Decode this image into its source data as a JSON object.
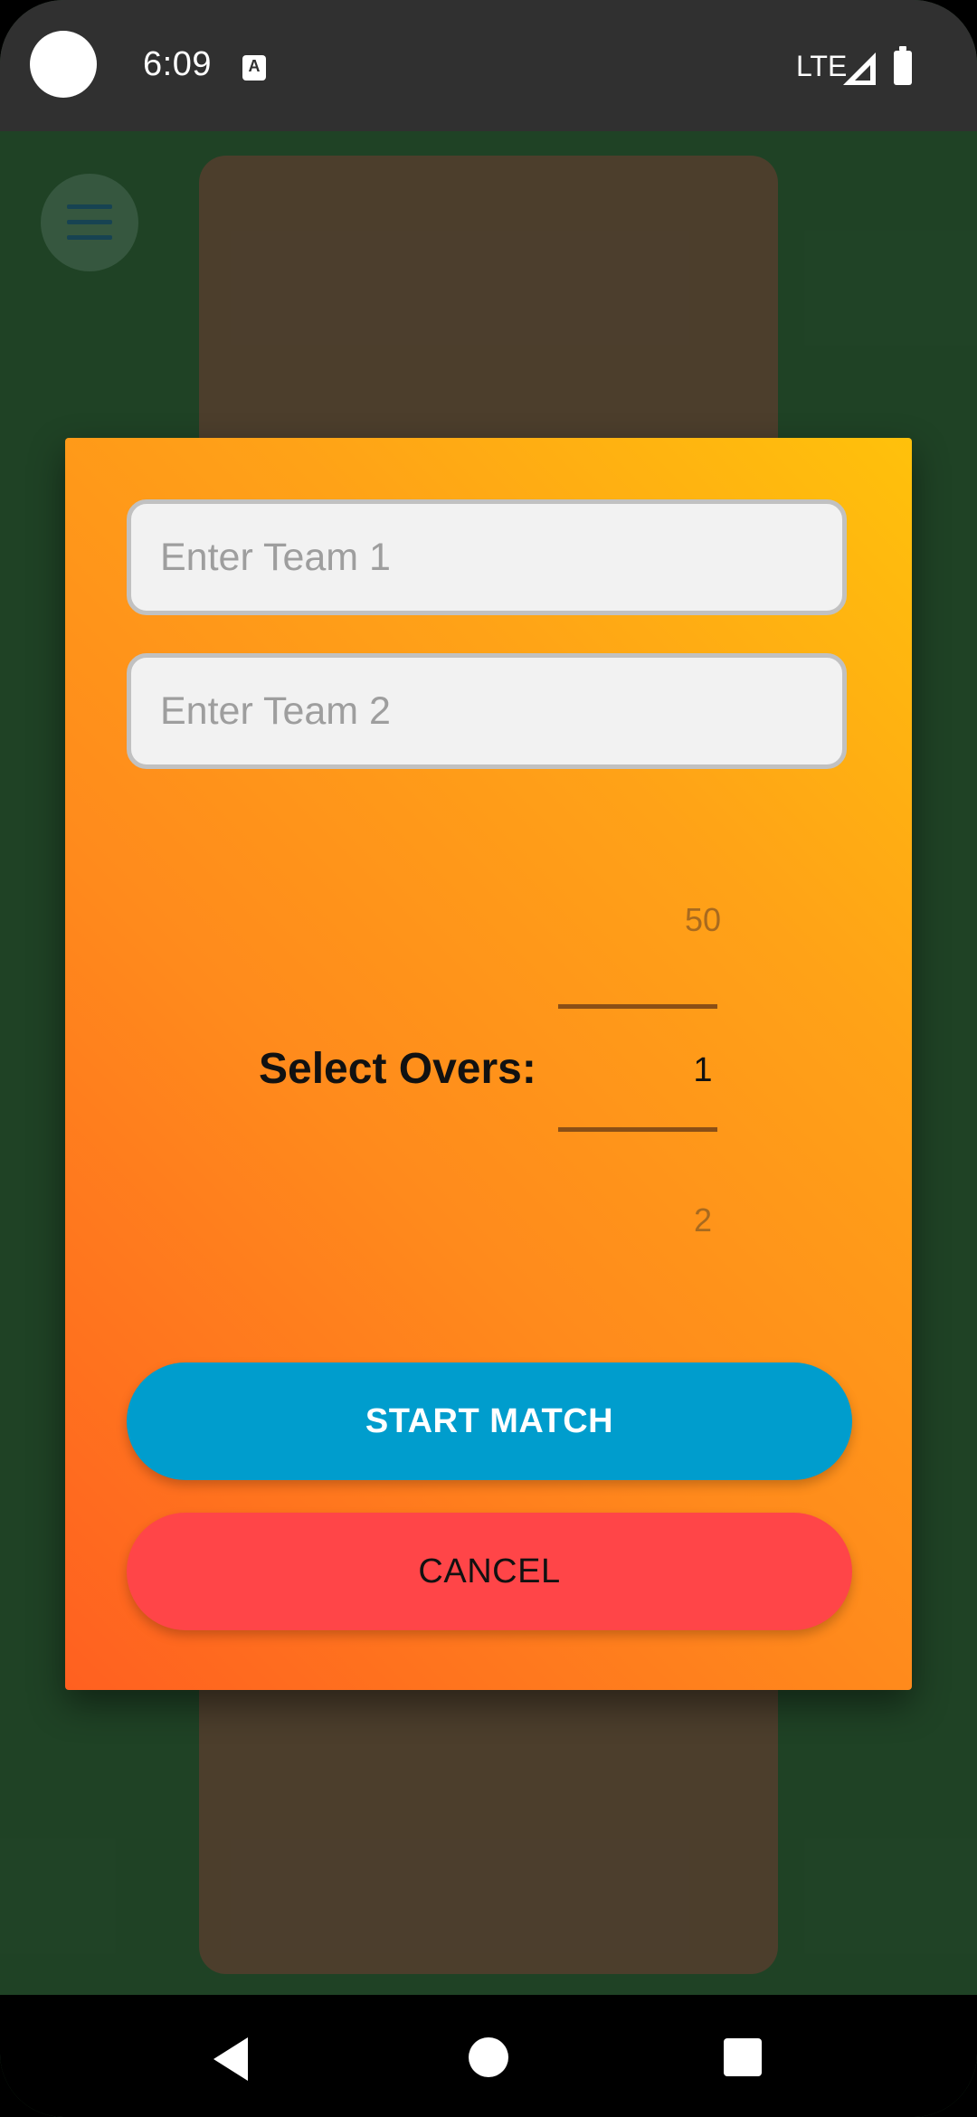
{
  "status_bar": {
    "time": "6:09",
    "input_indicator": "A",
    "network": "LTE",
    "icons": [
      "camera-cutout",
      "keyboard-a-icon",
      "signal-icon",
      "battery-icon"
    ]
  },
  "background": {
    "menu_icon": "hamburger-menu-icon"
  },
  "dialog": {
    "team1_placeholder": "Enter Team 1",
    "team2_placeholder": "Enter Team 2",
    "overs_label": "Select Overs:",
    "overs_picker": {
      "previous": "50",
      "selected": "1",
      "next": "2"
    },
    "start_button": "START MATCH",
    "cancel_button": "CANCEL"
  },
  "nav_bar": {
    "icons": [
      "back-icon",
      "home-icon",
      "recents-icon"
    ]
  },
  "colors": {
    "start_button": "#009dcd",
    "cancel_button": "#ff4548",
    "dialog_gradient_start": "#ff6020",
    "dialog_gradient_end": "#ffc10b",
    "background": "#244c2b",
    "pitch": "#574733"
  }
}
